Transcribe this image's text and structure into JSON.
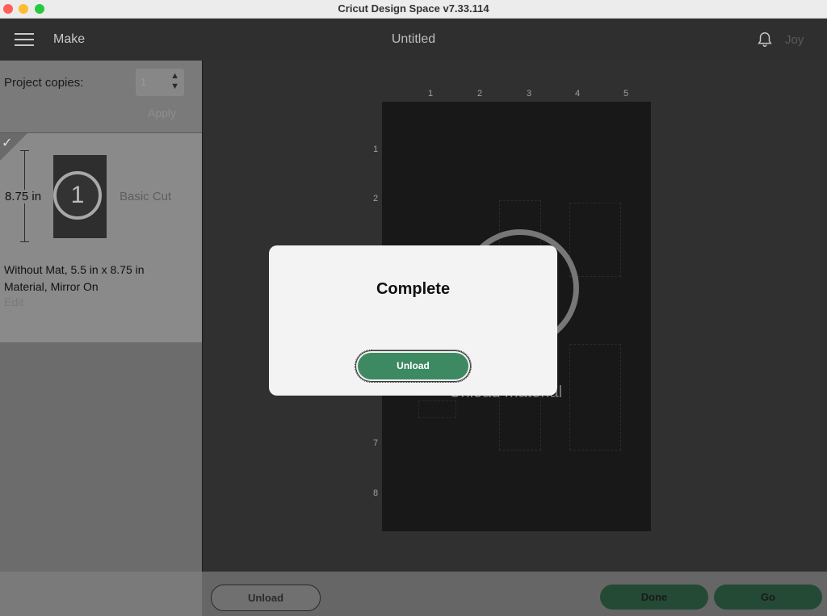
{
  "window": {
    "title": "Cricut Design Space  v7.33.114"
  },
  "header": {
    "menu_label": "Make",
    "project_title": "Untitled",
    "user": "Joy"
  },
  "left_panel": {
    "copies_label": "Project copies:",
    "copies_value": "1",
    "apply_label": "Apply",
    "mat": {
      "number": "1",
      "height_label": "8.75 in",
      "operation": "Basic Cut",
      "description_line1": "Without Mat, 5.5 in x 8.75 in",
      "description_line2": "Material, Mirror On",
      "edit_label": "Edit"
    }
  },
  "canvas": {
    "ruler_top": [
      "1",
      "2",
      "3",
      "4",
      "5"
    ],
    "ruler_left": [
      "1",
      "2",
      "7",
      "8"
    ],
    "status_text": "Unload material"
  },
  "modal": {
    "title": "Complete",
    "button_label": "Unload"
  },
  "bottom_bar": {
    "unload_label": "Unload",
    "done_label": "Done",
    "go_label": "Go"
  },
  "colors": {
    "accent_green": "#3d8a62",
    "dark_green": "#244a36"
  }
}
